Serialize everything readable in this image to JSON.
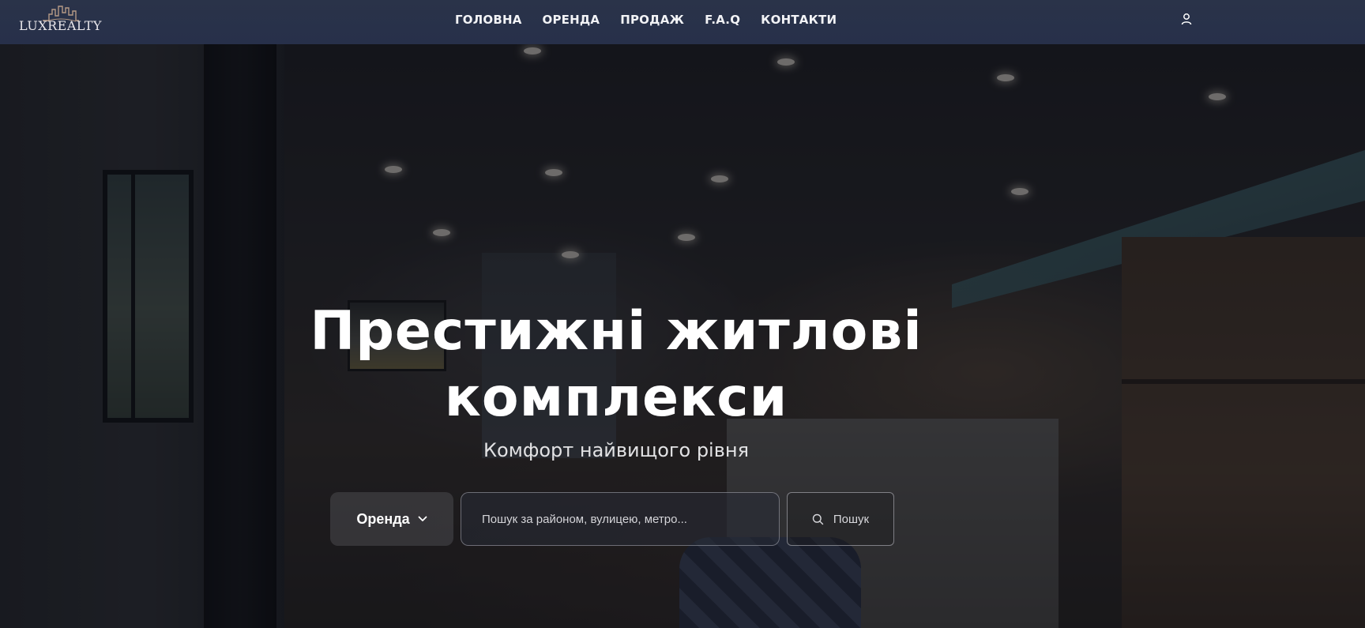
{
  "brand": {
    "logo_text": "LUXREALTY"
  },
  "nav": {
    "items": [
      {
        "label": "ГОЛОВНА"
      },
      {
        "label": "ОРЕНДА"
      },
      {
        "label": "ПРОДАЖ"
      },
      {
        "label": "F.A.Q"
      },
      {
        "label": "КОНТАКТИ"
      }
    ]
  },
  "header": {
    "user_icon": "user-icon"
  },
  "hero": {
    "title_line1": "Престижні житлові",
    "title_line2": "комплекси",
    "subtitle": "Комфорт найвищого рівня"
  },
  "search": {
    "mode_selected": "Оренда",
    "mode_icon": "chevron-down-icon",
    "placeholder": "Пошук за районом, вулицею, метро...",
    "value": "",
    "button_label": "Пошук",
    "button_icon": "search-icon"
  },
  "colors": {
    "header_bg": "#28314a",
    "text_primary": "#ffffff",
    "overlay": "#0c0e14"
  }
}
